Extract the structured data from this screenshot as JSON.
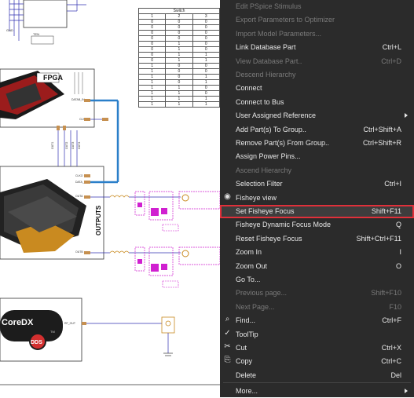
{
  "schematic": {
    "fpga_label": "FPGA",
    "outputs_label": "OUTPUTS",
    "coredx_label": "CoreDX",
    "dds_label": "DDS",
    "tm_label": "TM",
    "pin_labels": [
      "DATAB_IN",
      "CLKI",
      "OUT1",
      "OUT2",
      "OUT3",
      "OUT4",
      "CLKO",
      "DATA_IN",
      "OUTA",
      "OUTB",
      "RF_OUT",
      "GND",
      "TEN"
    ],
    "truth_table": {
      "title": "Switch",
      "headers": [
        "1",
        "2",
        "3"
      ],
      "rows": [
        [
          "0",
          "0",
          "0"
        ],
        [
          "0",
          "0",
          "0"
        ],
        [
          "0",
          "0",
          "0"
        ],
        [
          "0",
          "0",
          "0"
        ],
        [
          "0",
          "1",
          "0"
        ],
        [
          "0",
          "1",
          "0"
        ],
        [
          "0",
          "1",
          "1"
        ],
        [
          "0",
          "1",
          "1"
        ],
        [
          "1",
          "0",
          "0"
        ],
        [
          "1",
          "0",
          "0"
        ],
        [
          "1",
          "0",
          "1"
        ],
        [
          "1",
          "0",
          "1"
        ],
        [
          "1",
          "1",
          "0"
        ],
        [
          "1",
          "1",
          "0"
        ],
        [
          "1",
          "1",
          "1"
        ],
        [
          "1",
          "1",
          "1"
        ]
      ]
    }
  },
  "context_menu": {
    "items": [
      {
        "label": "Edit PSpice Stimulus",
        "shortcut": "",
        "disabled": true
      },
      {
        "label": "Export Parameters to Optimizer",
        "shortcut": "",
        "disabled": true
      },
      {
        "label": "Import Model Parameters...",
        "shortcut": "",
        "disabled": true
      },
      {
        "label": "Link Database Part",
        "shortcut": "Ctrl+L",
        "disabled": false
      },
      {
        "label": "View Database Part..",
        "shortcut": "Ctrl+D",
        "disabled": true
      },
      {
        "label": "Descend Hierarchy",
        "shortcut": "",
        "disabled": true
      },
      {
        "label": "Connect",
        "shortcut": "",
        "disabled": false
      },
      {
        "label": "Connect to Bus",
        "shortcut": "",
        "disabled": false
      },
      {
        "label": "User Assigned Reference",
        "shortcut": "",
        "disabled": false,
        "submenu": true
      },
      {
        "label": "Add Part(s) To Group..",
        "shortcut": "Ctrl+Shift+A",
        "disabled": false
      },
      {
        "label": "Remove Part(s) From Group..",
        "shortcut": "Ctrl+Shift+R",
        "disabled": false
      },
      {
        "label": "Assign Power Pins...",
        "shortcut": "",
        "disabled": false
      },
      {
        "label": "Ascend Hierarchy",
        "shortcut": "",
        "disabled": true
      },
      {
        "label": "Selection Filter",
        "shortcut": "Ctrl+I",
        "disabled": false
      },
      {
        "label": "Fisheye view",
        "shortcut": "",
        "disabled": false,
        "icon": "eye-icon"
      },
      {
        "label": "Set Fisheye Focus",
        "shortcut": "Shift+F11",
        "disabled": false,
        "highlighted": true
      },
      {
        "label": "Fisheye Dynamic Focus Mode",
        "shortcut": "Q",
        "disabled": false
      },
      {
        "label": "Reset Fisheye Focus",
        "shortcut": "Shift+Ctrl+F11",
        "disabled": false
      },
      {
        "label": "Zoom In",
        "shortcut": "I",
        "disabled": false
      },
      {
        "label": "Zoom Out",
        "shortcut": "O",
        "disabled": false
      },
      {
        "label": "Go To...",
        "shortcut": "",
        "disabled": false
      },
      {
        "label": "Previous page...",
        "shortcut": "Shift+F10",
        "disabled": true
      },
      {
        "label": "Next Page...",
        "shortcut": "F10",
        "disabled": true
      },
      {
        "label": "Find...",
        "shortcut": "Ctrl+F",
        "disabled": false,
        "icon": "magnifier-icon"
      },
      {
        "label": "ToolTip",
        "shortcut": "",
        "disabled": false,
        "icon": "checkmark-icon"
      },
      {
        "label": "Cut",
        "shortcut": "Ctrl+X",
        "disabled": false,
        "icon": "scissors-icon"
      },
      {
        "label": "Copy",
        "shortcut": "Ctrl+C",
        "disabled": false,
        "icon": "copy-icon"
      },
      {
        "label": "Delete",
        "shortcut": "Del",
        "disabled": false
      },
      {
        "label": "More...",
        "shortcut": "",
        "disabled": false,
        "submenu": true
      }
    ],
    "colors": {
      "background": "#2b2b2b",
      "text": "#e8e8e8",
      "disabled_text": "#7a7a7a",
      "highlight_border": "#e0303a"
    }
  }
}
